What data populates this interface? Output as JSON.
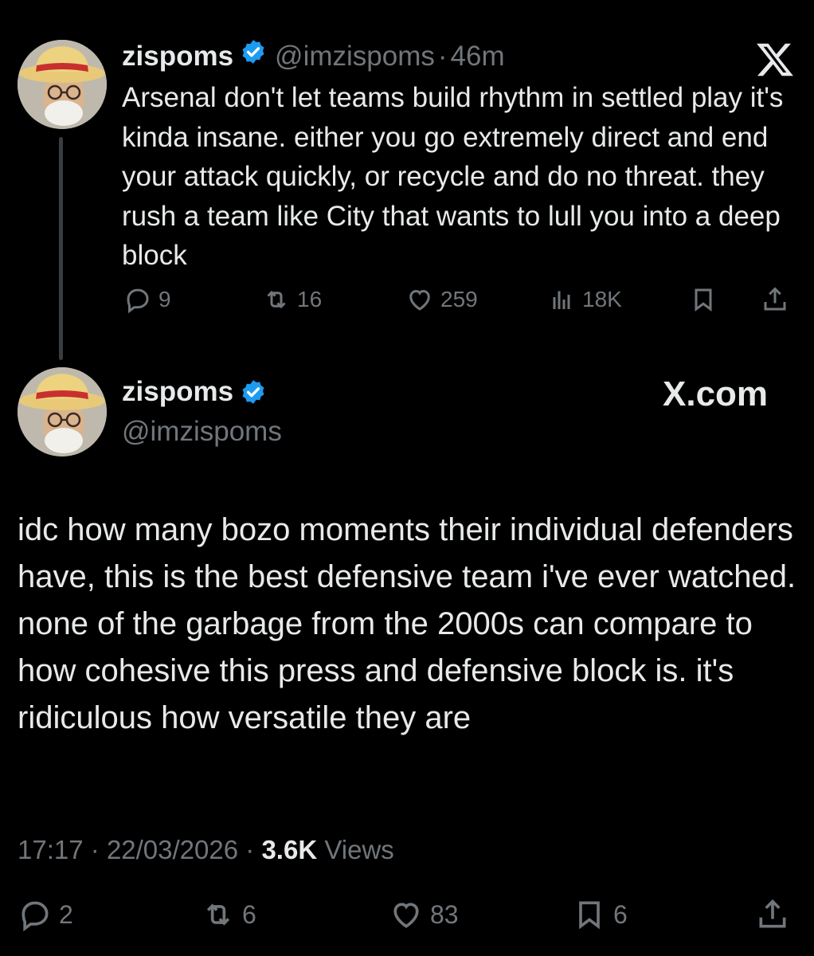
{
  "tweet1": {
    "name": "zispoms",
    "handle": "@imzispoms",
    "separator": "·",
    "time": "46m",
    "text": "Arsenal don't let teams build rhythm in settled play it's kinda insane. either you go extremely direct and end your attack quickly, or recycle and do no threat. they rush a team like City that wants to lull you into a deep block",
    "replies": "9",
    "retweets": "16",
    "likes": "259",
    "views": "18K"
  },
  "tweet2": {
    "name": "zispoms",
    "handle": "@imzispoms",
    "site": "X.com",
    "text": "idc how many bozo moments their individual defenders have, this is the best defensive team i've ever watched. none of the garbage from the 2000s can compare to how cohesive this press and defensive block is. it's ridiculous how versatile they are",
    "time": "17:17",
    "date": "22/03/2026",
    "views_count": "3.6K",
    "views_label": "Views",
    "replies": "2",
    "retweets": "6",
    "likes": "83",
    "bookmarks": "6"
  },
  "colors": {
    "background": "#000000",
    "text": "#e7e9ea",
    "muted": "#71767b",
    "verified": "#1d9bf0"
  },
  "icons": [
    "x-logo",
    "verified-badge-icon",
    "reply-icon",
    "retweet-icon",
    "like-icon",
    "views-icon",
    "bookmark-icon",
    "share-icon"
  ]
}
